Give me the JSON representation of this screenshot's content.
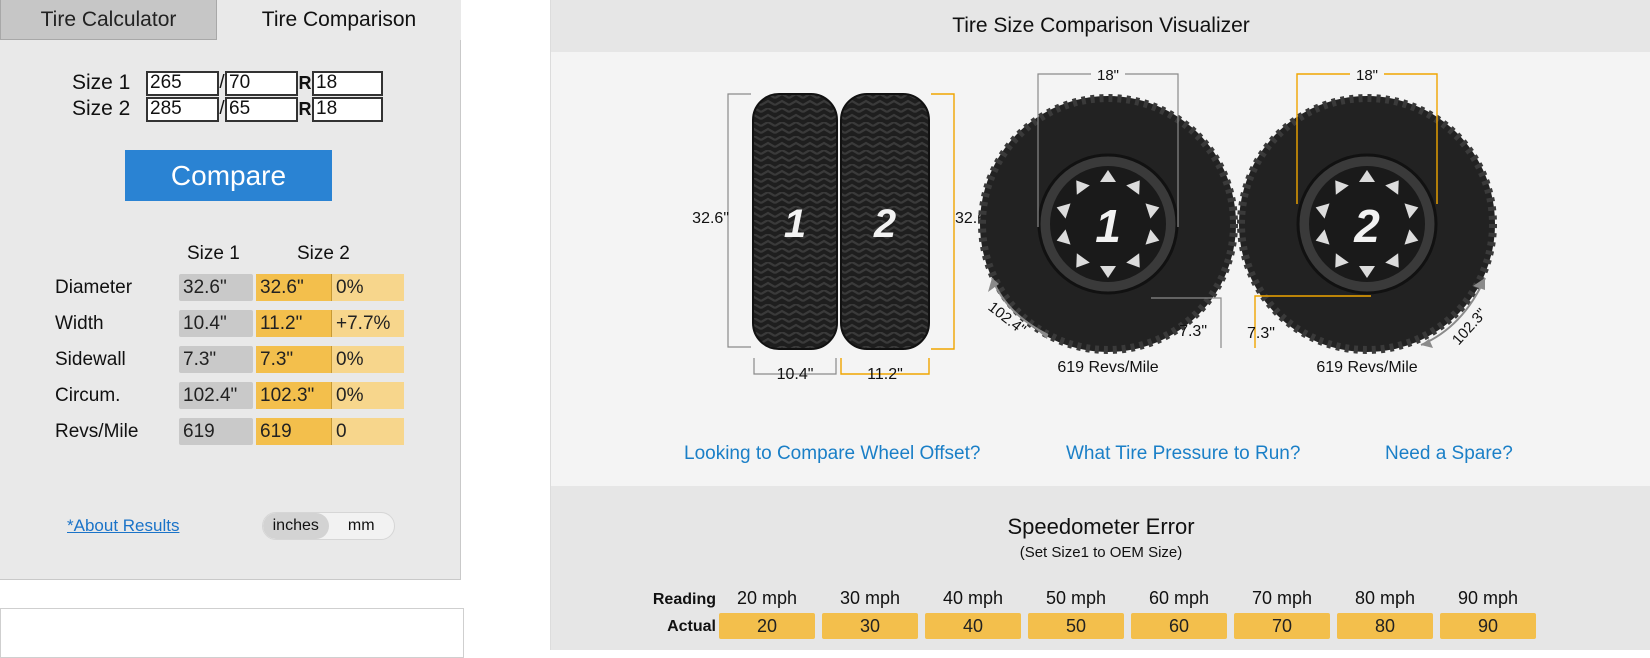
{
  "tabs": {
    "calculator": "Tire Calculator",
    "comparison": "Tire Comparison"
  },
  "inputs": {
    "size1": {
      "label": "Size 1",
      "width": "265",
      "aspect": "70",
      "rim": "18"
    },
    "size2": {
      "label": "Size 2",
      "width": "285",
      "aspect": "65",
      "rim": "18"
    },
    "slash": "/",
    "r": "R"
  },
  "compare_label": "Compare",
  "results": {
    "headers": [
      "Size 1",
      "Size 2"
    ],
    "rows": [
      {
        "label": "Diameter",
        "s1": "32.6\"",
        "s2": "32.6\"",
        "diff": "0%"
      },
      {
        "label": "Width",
        "s1": "10.4\"",
        "s2": "11.2\"",
        "diff": "+7.7%"
      },
      {
        "label": "Sidewall",
        "s1": "7.3\"",
        "s2": "7.3\"",
        "diff": "0%"
      },
      {
        "label": "Circum.",
        "s1": "102.4\"",
        "s2": "102.3\"",
        "diff": "0%"
      },
      {
        "label": "Revs/Mile",
        "s1": "619",
        "s2": "619",
        "diff": "0"
      }
    ]
  },
  "about_link": "*About Results",
  "units": {
    "inches": "inches",
    "mm": "mm",
    "active": "inches"
  },
  "visualizer": {
    "title": "Tire Size Comparison Visualizer",
    "tread1": {
      "number": "1",
      "height": "32.6\"",
      "width": "10.4\""
    },
    "tread2": {
      "number": "2",
      "height": "32.6\"",
      "width": "11.2\""
    },
    "wheel1": {
      "number": "1",
      "rim": "18\"",
      "sidewall": "7.3\"",
      "circum": "102.4\"",
      "revs": "619 Revs/Mile"
    },
    "wheel2": {
      "number": "2",
      "rim": "18\"",
      "sidewall": "7.3\"",
      "circum": "102.3\"",
      "revs": "619 Revs/Mile"
    },
    "colors": {
      "accent": "#f0a500",
      "gray_line": "#8a8a8a",
      "tire": "#222222"
    }
  },
  "links": [
    "Looking to Compare Wheel Offset?",
    "What Tire Pressure to Run?",
    "Need a Spare?"
  ],
  "speedometer": {
    "title": "Speedometer Error",
    "subtitle": "(Set Size1 to OEM Size)",
    "reading_label": "Reading",
    "actual_label": "Actual",
    "readings": [
      "20 mph",
      "30 mph",
      "40 mph",
      "50 mph",
      "60 mph",
      "70 mph",
      "80 mph",
      "90 mph"
    ],
    "actuals": [
      "20",
      "30",
      "40",
      "50",
      "60",
      "70",
      "80",
      "90"
    ]
  }
}
